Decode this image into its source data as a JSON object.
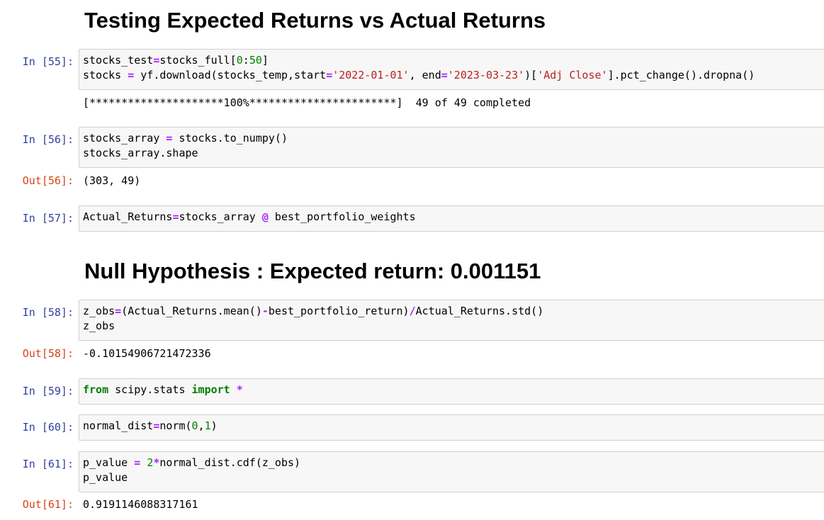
{
  "headings": {
    "h1": "Testing Expected Returns vs Actual Returns",
    "h2": "Null Hypothesis : Expected return: 0.001151"
  },
  "cells": [
    {
      "prompt": "In [55]:",
      "lines": [
        [
          [
            "",
            "stocks_test"
          ],
          [
            "o",
            "="
          ],
          [
            "",
            "stocks_full["
          ],
          [
            "n",
            "0"
          ],
          [
            "",
            ":"
          ],
          [
            "n",
            "50"
          ],
          [
            "",
            "]"
          ]
        ],
        [
          [
            "",
            "stocks "
          ],
          [
            "o",
            "="
          ],
          [
            "",
            " yf.download(stocks_temp,start"
          ],
          [
            "o",
            "="
          ],
          [
            "s",
            "'2022-01-01'"
          ],
          [
            "",
            ", end"
          ],
          [
            "o",
            "="
          ],
          [
            "s",
            "'2023-03-23'"
          ],
          [
            "",
            ")["
          ],
          [
            "s",
            "'Adj Close'"
          ],
          [
            "",
            "].pct_change().dropna()"
          ]
        ]
      ],
      "output": {
        "prompt": "",
        "text": "[*********************100%***********************]  49 of 49 completed"
      }
    },
    {
      "prompt": "In [56]:",
      "lines": [
        [
          [
            "",
            "stocks_array "
          ],
          [
            "o",
            "="
          ],
          [
            "",
            " stocks.to_numpy()"
          ]
        ],
        [
          [
            "",
            "stocks_array.shape"
          ]
        ]
      ],
      "output": {
        "prompt": "Out[56]:",
        "text": "(303, 49)"
      }
    },
    {
      "prompt": "In [57]:",
      "lines": [
        [
          [
            "",
            "Actual_Returns"
          ],
          [
            "o",
            "="
          ],
          [
            "",
            "stocks_array "
          ],
          [
            "o",
            "@"
          ],
          [
            "",
            " best_portfolio_weights"
          ]
        ]
      ]
    },
    {
      "prompt": "In [58]:",
      "lines": [
        [
          [
            "",
            "z_obs"
          ],
          [
            "o",
            "="
          ],
          [
            "",
            "(Actual_Returns.mean()"
          ],
          [
            "o",
            "-"
          ],
          [
            "",
            "best_portfolio_return)"
          ],
          [
            "o",
            "/"
          ],
          [
            "",
            "Actual_Returns.std()"
          ]
        ],
        [
          [
            "",
            "z_obs"
          ]
        ]
      ],
      "output": {
        "prompt": "Out[58]:",
        "text": "-0.10154906721472336"
      }
    },
    {
      "prompt": "In [59]:",
      "lines": [
        [
          [
            "k",
            "from"
          ],
          [
            "",
            " scipy.stats "
          ],
          [
            "k",
            "import"
          ],
          [
            "",
            " "
          ],
          [
            "o",
            "*"
          ]
        ]
      ]
    },
    {
      "prompt": "In [60]:",
      "lines": [
        [
          [
            "",
            "normal_dist"
          ],
          [
            "o",
            "="
          ],
          [
            "",
            "norm("
          ],
          [
            "n",
            "0"
          ],
          [
            "",
            ","
          ],
          [
            "n",
            "1"
          ],
          [
            "",
            ")"
          ]
        ]
      ]
    },
    {
      "prompt": "In [61]:",
      "lines": [
        [
          [
            "",
            "p_value "
          ],
          [
            "o",
            "="
          ],
          [
            "",
            " "
          ],
          [
            "n",
            "2"
          ],
          [
            "o",
            "*"
          ],
          [
            "",
            "normal_dist.cdf(z_obs)"
          ]
        ],
        [
          [
            "",
            "p_value"
          ]
        ]
      ],
      "output": {
        "prompt": "Out[61]:",
        "text": "0.9191146088317161"
      }
    }
  ]
}
